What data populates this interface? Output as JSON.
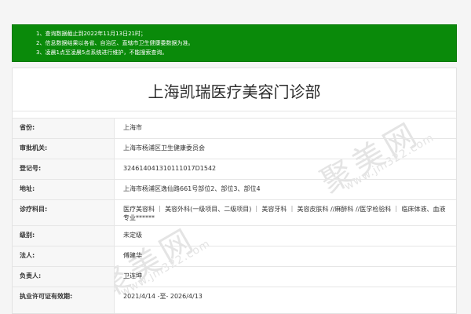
{
  "notice": {
    "lines": [
      "1、查询数据截止到2022年11月13日21时；",
      "2、信息数据结果以各省、自治区、直辖市卫生健康委数据为准。",
      "3、凌晨1点至凌晨5点系统进行维护，不能搜索查询。"
    ]
  },
  "clinic": {
    "name": "上海凯瑞医疗美容门诊部"
  },
  "details": [
    {
      "label": "省份:",
      "value": "上海市"
    },
    {
      "label": "审批机关:",
      "value": "上海市杨浦区卫生健康委员会"
    },
    {
      "label": "登记号:",
      "value": "324614041310111017D1542"
    },
    {
      "label": "地址:",
      "value": "上海市杨浦区逸仙路661号部位2、部位3、部位4"
    },
    {
      "label": "诊疗科目:",
      "value": "医疗美容科 ｜ 美容外科(一级项目、二级项目) ｜ 美容牙科 ｜ 美容皮肤科 //麻醉科 //医学检验科 ｜ 临床体液、血液专业******"
    },
    {
      "label": "级别:",
      "value": "未定级"
    },
    {
      "label": "法人:",
      "value": "傅建华"
    },
    {
      "label": "负责人:",
      "value": "卫连坤"
    },
    {
      "label": "执业许可证有效期:",
      "value": "2021/4/14 -至- 2026/4/13"
    }
  ],
  "watermark": {
    "text": "聚美网",
    "url": "www.jm322.com"
  },
  "colors": {
    "notice_background": "#0a8a0a",
    "notice_text": "#ffffff",
    "label_background": "#f7f7f7",
    "border": "#e6e6e6"
  }
}
